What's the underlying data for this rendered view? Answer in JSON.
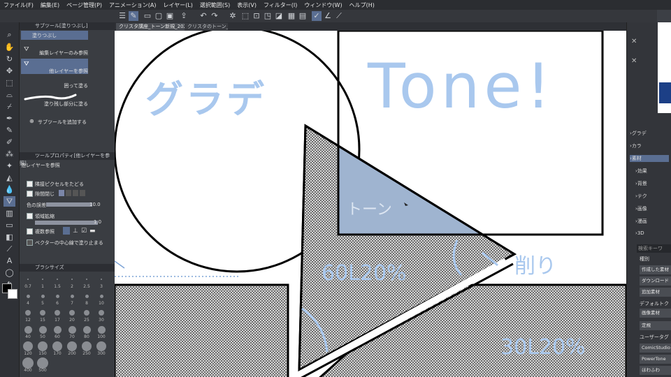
{
  "menu": [
    "ファイル(F)",
    "編集(E)",
    "ページ管理(P)",
    "アニメーション(A)",
    "レイヤー(L)",
    "選択範囲(S)",
    "表示(V)",
    "フィルター(I)",
    "ウィンドウ(W)",
    "ヘルプ(H)"
  ],
  "tabs": {
    "doc1": "クリスタ講座_トーン新規_2021*",
    "doc2": "クリスタのトーン_CI"
  },
  "subtool_panel": {
    "title": "サブツール[塗りつぶし]",
    "items": [
      {
        "label": "塗りつぶし",
        "selected": true
      },
      {
        "label": "編集レイヤーのみ参照",
        "selected": false
      },
      {
        "label": "他レイヤーを参照",
        "selected": true
      },
      {
        "label": "囲って塗る",
        "selected": false
      },
      {
        "label": "塗り残し部分に塗る",
        "selected": false
      }
    ],
    "add_label": "サブツールを追加する"
  },
  "tool_property": {
    "title": "ツールプロパティ[他レイヤーを参照]",
    "subtitle": "他レイヤーを参照",
    "rows": {
      "adjacent": "隣接ピクセルをたどる",
      "close_gap": "隙間閉じ",
      "color_margin": "色の誤差",
      "color_margin_value": "10.0",
      "expand": "領域拡縮",
      "expand_value": "1.0",
      "multi_ref": "複数参照",
      "vector_center": "ベクターの中心線で塗り止まる"
    }
  },
  "brush_panel": {
    "title": "ブラシサイズ",
    "sizes": [
      "0.7",
      "1",
      "1.5",
      "2",
      "2.5",
      "3",
      "4",
      "5",
      "6",
      "7",
      "8",
      "10",
      "12",
      "15",
      "17",
      "20",
      "25",
      "30",
      "40",
      "50",
      "60",
      "70",
      "80",
      "100",
      "120",
      "150",
      "170",
      "200",
      "250",
      "300",
      "400",
      "500"
    ]
  },
  "canvas_text": {
    "gradient": "グラデ",
    "tone": "Tone!",
    "tone_label": "トーン",
    "percent1": "60L20%",
    "percent2": "30L20%",
    "shave": "削り"
  },
  "right_panel": {
    "tree": [
      "グラデ",
      "カラ",
      "素材",
      "効果",
      "背景",
      "テク",
      "画像",
      "漫画",
      "3D"
    ],
    "search_placeholder": "検索キーワ",
    "category": "種別",
    "buttons": [
      "作成した素材",
      "ダウンロード",
      "追加素材",
      "デフォルトク",
      "画像素材",
      "定規"
    ],
    "section": "ユーザータグ",
    "tags": [
      "ComicStudio",
      "PowerTone",
      "ほわふわ"
    ]
  },
  "colors": {
    "accent_blue": "#a9c8ee",
    "tone_fill": "#9fb4d0",
    "selection": "#5a6e92"
  }
}
